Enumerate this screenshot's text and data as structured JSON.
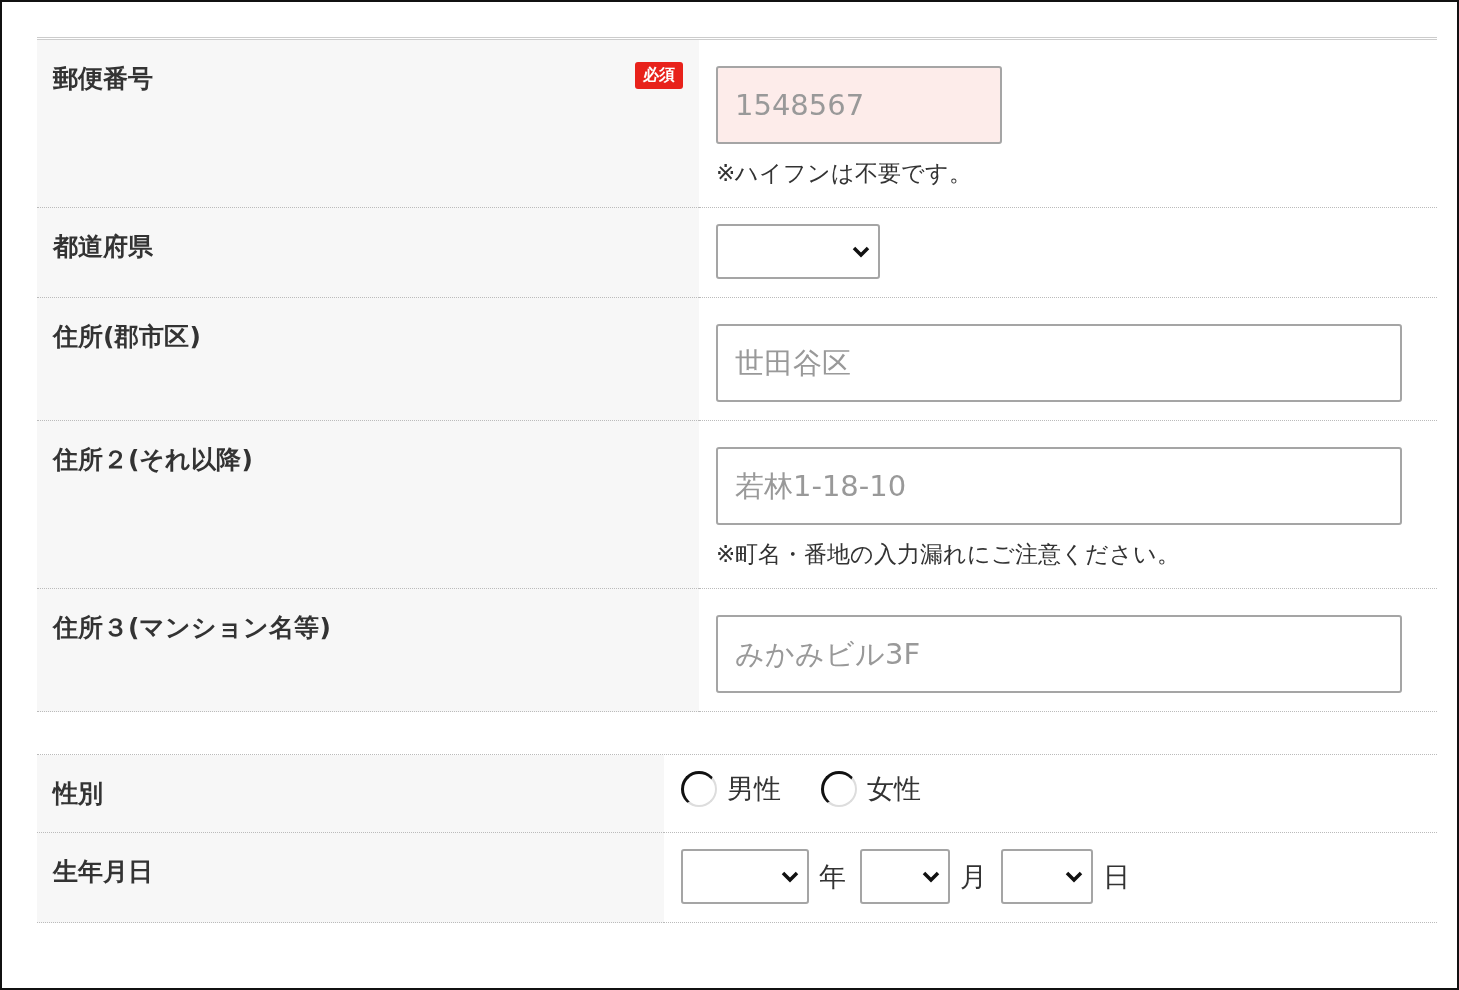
{
  "address_section": [
    {
      "label": "郵便番号",
      "required_badge": "必須",
      "kind": "code",
      "placeholder": "1548567",
      "note": "※ハイフンは不要です。"
    },
    {
      "label": "都道府県",
      "kind": "select"
    },
    {
      "label": "住所(郡市区)",
      "kind": "text",
      "placeholder": "世田谷区"
    },
    {
      "label": "住所２(それ以降)",
      "kind": "text",
      "placeholder": "若林1-18-10",
      "note": "※町名・番地の入力漏れにご注意ください。"
    },
    {
      "label": "住所３(マンション名等)",
      "kind": "text",
      "placeholder": "みかみビル3F"
    }
  ],
  "profile_section": [
    {
      "label": "性別",
      "kind": "radio",
      "options": [
        {
          "label": "男性",
          "selected": false
        },
        {
          "label": "女性",
          "selected": false
        }
      ]
    },
    {
      "label": "生年月日",
      "kind": "date",
      "parts": [
        {
          "unit": "年",
          "kind": "year"
        },
        {
          "unit": "月",
          "kind": "month"
        },
        {
          "unit": "日",
          "kind": "day"
        }
      ]
    }
  ]
}
